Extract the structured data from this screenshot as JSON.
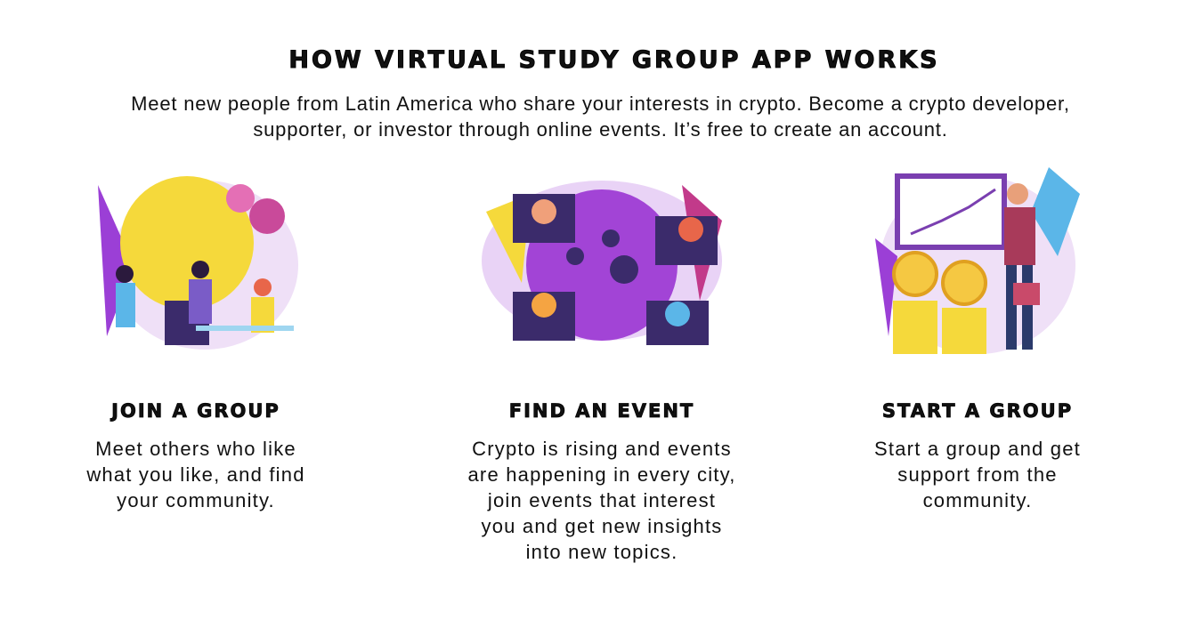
{
  "header": {
    "title": "HOW VIRTUAL STUDY GROUP APP WORKS",
    "subtitle_lines": [
      "Meet new people from Latin America who share your interests in crypto. Become a crypto developer,",
      "supporter, or investor through online events. It’s free to create an account."
    ]
  },
  "steps": [
    {
      "heading": "JOIN A GROUP",
      "icon": "lightbulb-team-illustration",
      "lines": [
        "Meet others who like",
        "what you like, and find",
        "your community."
      ]
    },
    {
      "heading": "FIND AN EVENT",
      "icon": "globe-video-call-illustration",
      "lines": [
        "Crypto is rising and events",
        "are happening in every city,",
        "join events that interest",
        "you and get new insights",
        "into new topics."
      ]
    },
    {
      "heading": "START A GROUP",
      "icon": "coins-presentation-illustration",
      "lines": [
        "Start a group and get",
        "support from the",
        "community."
      ]
    }
  ],
  "colors": {
    "purple": "#9b3fd6",
    "yellow": "#f5d93b",
    "pink": "#e46fb5",
    "lavender": "#e8d5f5"
  }
}
